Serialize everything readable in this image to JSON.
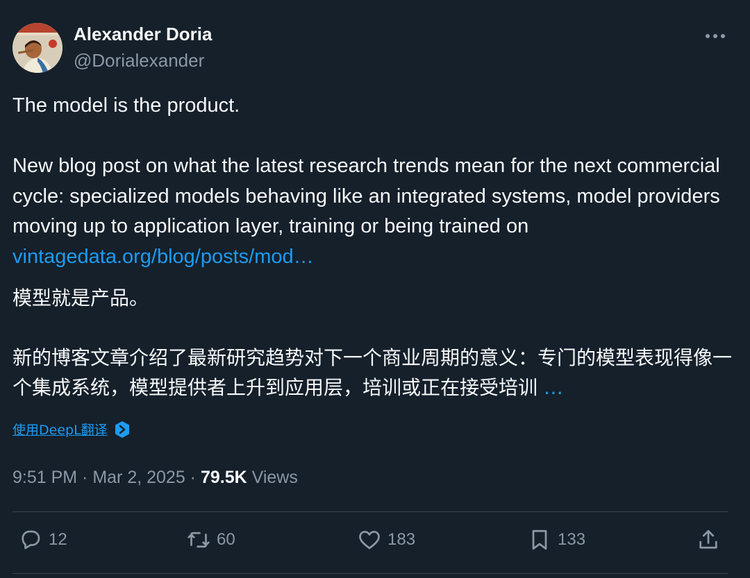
{
  "author": {
    "name": "Alexander Doria",
    "handle": "@Dorialexander"
  },
  "tweet": {
    "line1": "The model is the product.",
    "line2": "New blog post on what the latest research trends mean for the next commercial cycle: specialized models behaving like an integrated systems, model providers moving up to application layer, training or being trained on ",
    "link_text": "vintagedata.org/blog/posts/mod…"
  },
  "translation": {
    "line1": "模型就是产品。",
    "line2": "新的博客文章介绍了最新研究趋势对下一个商业周期的意义：专门的模型表现得像一个集成系统，模型提供者上升到应用层，培训或正在接受培训 ",
    "more": "…",
    "translate_label": "使用DeepL翻译"
  },
  "meta": {
    "time": "9:51 PM · Mar 2, 2025 · ",
    "views_count": "79.5K",
    "views_label": " Views"
  },
  "actions": {
    "replies": "12",
    "retweets": "60",
    "likes": "183",
    "bookmarks": "133"
  },
  "colors": {
    "background": "#15202b",
    "text": "#f7f9f9",
    "secondary": "#8b98a5",
    "accent": "#1d9bf0",
    "divider": "#38444d"
  }
}
